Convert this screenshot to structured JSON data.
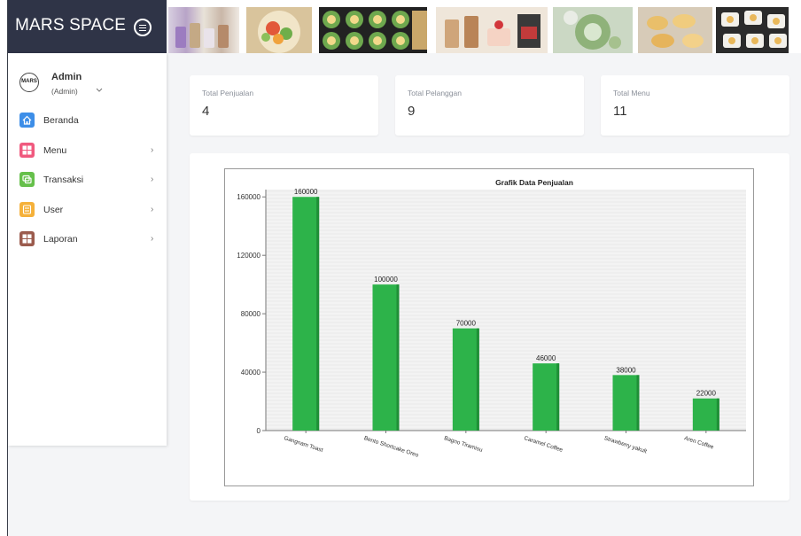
{
  "app": {
    "title": "MARS SPACE"
  },
  "icons": {
    "menu_toggle": "hamburger-circle-icon",
    "beranda": "home-icon",
    "menu": "grid-icon",
    "transaksi": "chat-icon",
    "user": "list-icon",
    "laporan": "grid-icon"
  },
  "colors": {
    "header_bg": "#2f3447",
    "bar": "#2db34a",
    "beranda": "#3d8ee8",
    "menu": "#f0597e",
    "transaksi": "#66c04b",
    "user": "#f5b13a",
    "laporan": "#9b5b4d"
  },
  "user": {
    "name": "Admin",
    "role": "(Admin)",
    "avatar_text": "MARS"
  },
  "sidebar": {
    "items": [
      {
        "label": "Beranda",
        "has_arrow": false
      },
      {
        "label": "Menu",
        "has_arrow": true
      },
      {
        "label": "Transaksi",
        "has_arrow": true
      },
      {
        "label": "User",
        "has_arrow": true
      },
      {
        "label": "Laporan",
        "has_arrow": true
      }
    ],
    "arrow": "›"
  },
  "stats": [
    {
      "label": "Total Penjualan",
      "value": "4"
    },
    {
      "label": "Total Pelanggan",
      "value": "9"
    },
    {
      "label": "Total Menu",
      "value": "11"
    }
  ],
  "chart_data": {
    "type": "bar",
    "title": "Grafik Data Penjualan",
    "categories": [
      "Gangnam Toast",
      "Bento Shortcake Oreo",
      "Bagno Tiramisu",
      "Caramel Coffee",
      "Strawberry yakult",
      "Aren Coffee"
    ],
    "values": [
      160000,
      100000,
      70000,
      46000,
      38000,
      22000
    ],
    "ylim": [
      0,
      165000
    ],
    "yticks": [
      0,
      40000,
      80000,
      120000,
      160000
    ],
    "xlabel": "",
    "ylabel": "",
    "grid": true,
    "legend": false
  }
}
